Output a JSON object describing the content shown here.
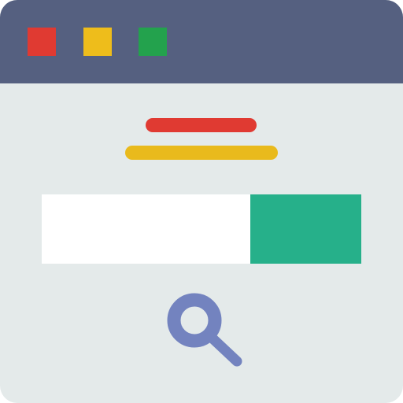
{
  "colors": {
    "titlebar": "#556080",
    "window_background": "#e4eaea",
    "close": "#e03a32",
    "minimize": "#eebd1b",
    "maximize": "#23a24d",
    "heading_line": "#e03a32",
    "subheading_line": "#e9ba1c",
    "search_input": "#ffffff",
    "search_button": "#26b08a",
    "search_icon": "#7383bf"
  },
  "icons": {
    "search": "search-icon",
    "close": "close-square",
    "minimize": "minimize-square",
    "maximize": "maximize-square"
  },
  "search": {
    "value": "",
    "placeholder": ""
  }
}
